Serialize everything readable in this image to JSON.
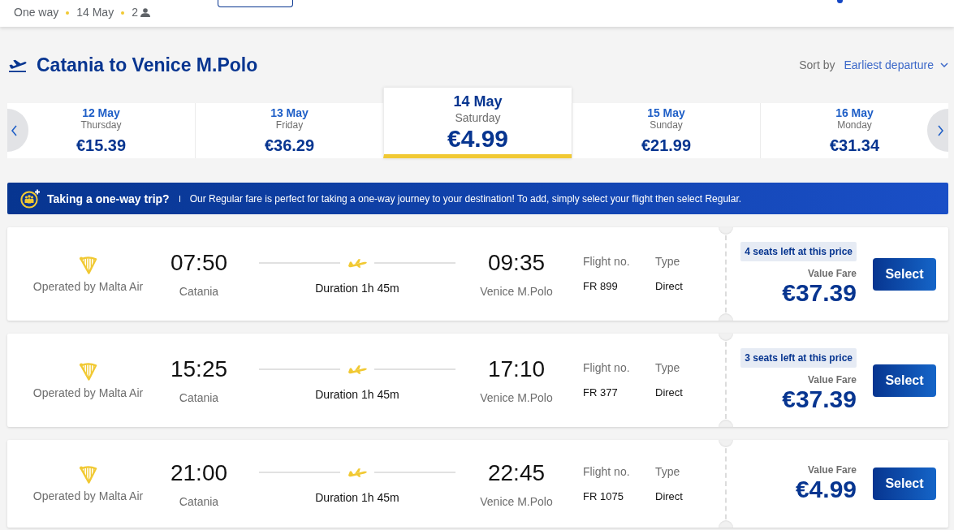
{
  "header": {
    "trip_type": "One way",
    "date": "14 May",
    "passengers": "2"
  },
  "route": {
    "title": "Catania to Venice M.Polo",
    "sort_label": "Sort by",
    "sort_value": "Earliest departure"
  },
  "dates": [
    {
      "date": "12 May",
      "weekday": "Thursday",
      "price": "€15.39",
      "selected": false
    },
    {
      "date": "13 May",
      "weekday": "Friday",
      "price": "€36.29",
      "selected": false
    },
    {
      "date": "14 May",
      "weekday": "Saturday",
      "price": "€4.99",
      "selected": true
    },
    {
      "date": "15 May",
      "weekday": "Sunday",
      "price": "€21.99",
      "selected": false
    },
    {
      "date": "16 May",
      "weekday": "Monday",
      "price": "€31.34",
      "selected": false
    }
  ],
  "banner": {
    "title": "Taking a one-way trip?",
    "text": "Our Regular fare is perfect for taking a one-way journey to your destination! To add, simply select your flight then select Regular."
  },
  "flights": [
    {
      "operator": "Operated by Malta Air",
      "departure_time": "07:50",
      "departure_airport": "Catania",
      "duration": "Duration 1h 45m",
      "arrival_time": "09:35",
      "arrival_airport": "Venice M.Polo",
      "flight_no_label": "Flight no.",
      "flight_no": "FR 899",
      "type_label": "Type",
      "type": "Direct",
      "seats_badge": "4 seats left at this price",
      "fare": "Value Fare",
      "price": "€37.39",
      "button": "Select"
    },
    {
      "operator": "Operated by Malta Air",
      "departure_time": "15:25",
      "departure_airport": "Catania",
      "duration": "Duration 1h 45m",
      "arrival_time": "17:10",
      "arrival_airport": "Venice M.Polo",
      "flight_no_label": "Flight no.",
      "flight_no": "FR 377",
      "type_label": "Type",
      "type": "Direct",
      "seats_badge": "3 seats left at this price",
      "fare": "Value Fare",
      "price": "€37.39",
      "button": "Select"
    },
    {
      "operator": "Operated by Malta Air",
      "departure_time": "21:00",
      "departure_airport": "Catania",
      "duration": "Duration 1h 45m",
      "arrival_time": "22:45",
      "arrival_airport": "Venice M.Polo",
      "flight_no_label": "Flight no.",
      "flight_no": "FR 1075",
      "type_label": "Type",
      "type": "Direct",
      "fare": "Value Fare",
      "price": "€4.99",
      "button": "Select"
    }
  ]
}
